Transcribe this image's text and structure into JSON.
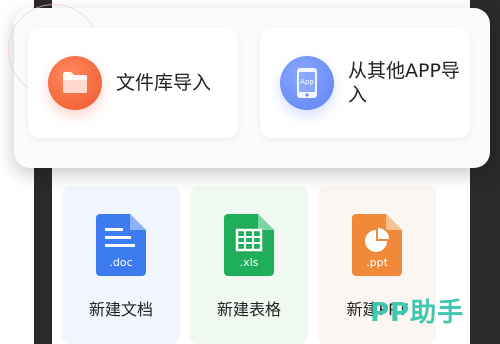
{
  "import_menu": {
    "file_library_label": "文件库导入",
    "other_app_label": "从其他APP导入",
    "app_icon_text": "App"
  },
  "new_files": {
    "doc": {
      "label": "新建文档",
      "ext": ".doc"
    },
    "xls": {
      "label": "新建表格",
      "ext": ".xls"
    },
    "ppt": {
      "label": "新建PPT",
      "ext": ".ppt"
    }
  },
  "watermark": "PP助手",
  "colors": {
    "orange": "#f0572f",
    "blue": "#5e83f2",
    "doc_blue": "#3d7cf0",
    "xls_green": "#1fae5a",
    "ppt_orange": "#f08a3a"
  }
}
